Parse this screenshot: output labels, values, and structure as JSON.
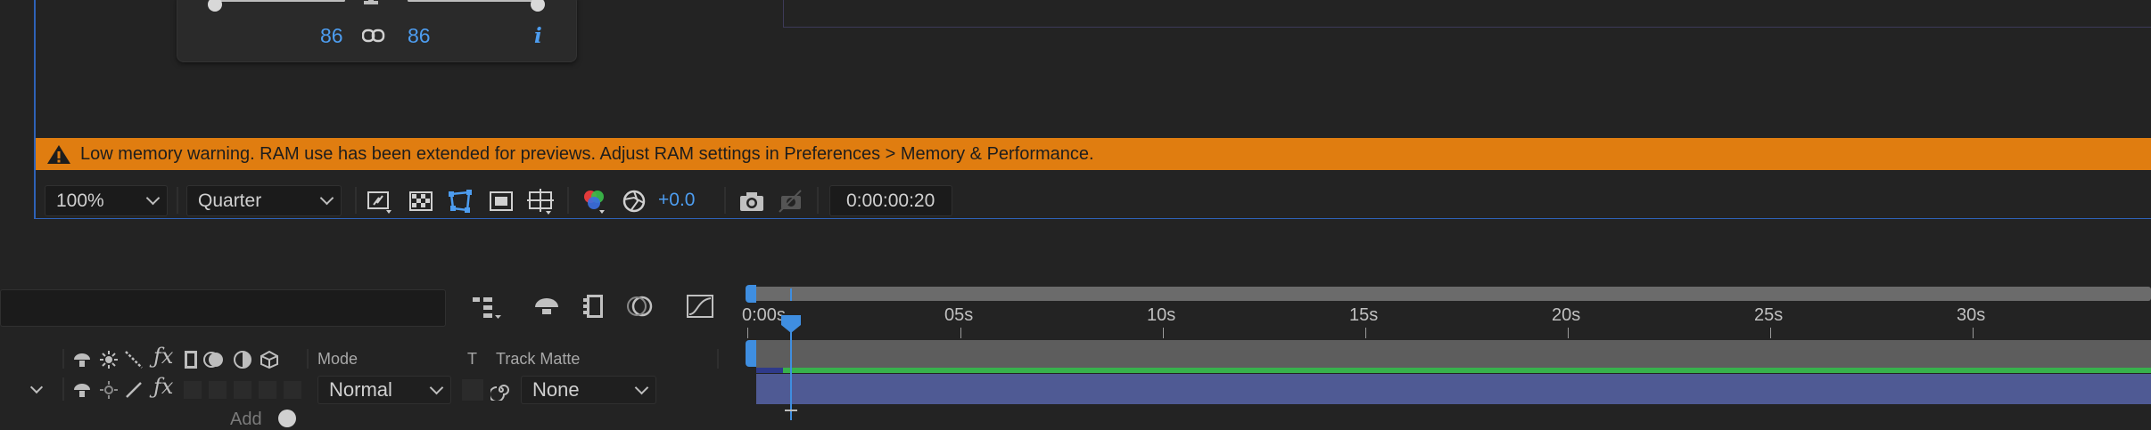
{
  "scale_panel": {
    "value_left": "86",
    "value_right": "86",
    "info_label": "i"
  },
  "warning": {
    "text": "Low memory warning. RAM use has been extended for previews. Adjust RAM settings in Preferences > Memory & Performance.",
    "color": "#e07d10"
  },
  "viewer_toolbar": {
    "zoom": "100%",
    "resolution": "Quarter",
    "exposure": "+0.0",
    "timecode": "0:00:00:20"
  },
  "timeline": {
    "ruler_labels": [
      "0:00s",
      "05s",
      "10s",
      "15s",
      "20s",
      "25s",
      "30s"
    ],
    "columns": {
      "mode": "Mode",
      "t": "T",
      "track_matte": "Track Matte"
    },
    "layer": {
      "mode": "Normal",
      "track_matte": "None"
    },
    "add_label": "Add"
  },
  "accent_color": "#2e62b8"
}
